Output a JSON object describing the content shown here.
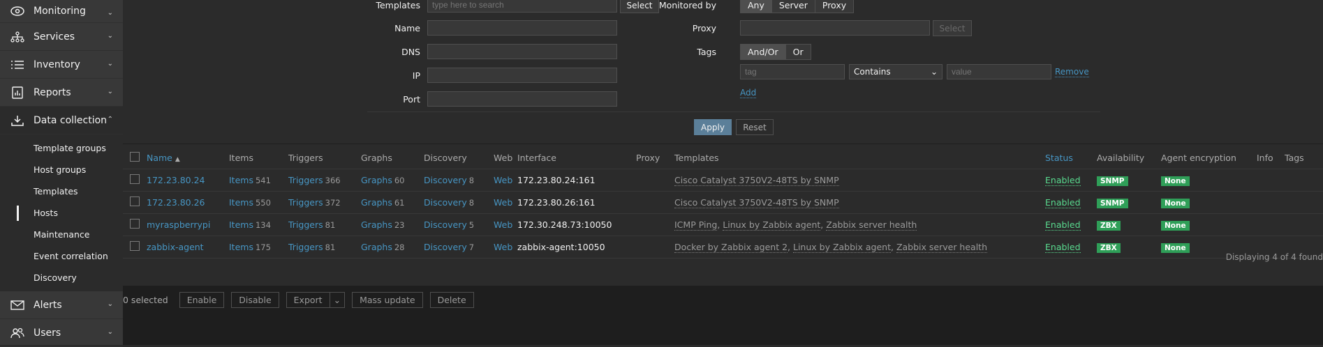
{
  "sidebar": {
    "top_items": [
      {
        "label": "Monitoring",
        "icon": "eye-icon"
      },
      {
        "label": "Services",
        "icon": "services-icon"
      },
      {
        "label": "Inventory",
        "icon": "list-icon"
      },
      {
        "label": "Reports",
        "icon": "report-icon"
      }
    ],
    "data_collection": {
      "label": "Data collection",
      "icon": "download-icon"
    },
    "sub_items": [
      "Template groups",
      "Host groups",
      "Templates",
      "Hosts",
      "Maintenance",
      "Event correlation",
      "Discovery"
    ],
    "bottom_items": [
      {
        "label": "Alerts",
        "icon": "envelope-icon"
      },
      {
        "label": "Users",
        "icon": "users-icon"
      }
    ]
  },
  "filter": {
    "templates_label": "Templates",
    "templates_placeholder": "type here to search",
    "select_label": "Select",
    "name_label": "Name",
    "dns_label": "DNS",
    "ip_label": "IP",
    "port_label": "Port",
    "monitored_by_label": "Monitored by",
    "monitored_options": [
      "Any",
      "Server",
      "Proxy"
    ],
    "proxy_label": "Proxy",
    "proxy_select_label": "Select",
    "tags_label": "Tags",
    "tags_options": [
      "And/Or",
      "Or"
    ],
    "tag_placeholder": "tag",
    "operator_value": "Contains",
    "value_placeholder": "value",
    "remove_label": "Remove",
    "add_label": "Add",
    "apply_label": "Apply",
    "reset_label": "Reset"
  },
  "table": {
    "headers": {
      "name": "Name",
      "items": "Items",
      "triggers": "Triggers",
      "graphs": "Graphs",
      "discovery": "Discovery",
      "web": "Web",
      "interface": "Interface",
      "proxy": "Proxy",
      "templates": "Templates",
      "status": "Status",
      "availability": "Availability",
      "encryption": "Agent encryption",
      "info": "Info",
      "tags": "Tags"
    },
    "sort_indicator": "▲",
    "rows": [
      {
        "name": "172.23.80.24",
        "items": "Items",
        "items_n": "541",
        "triggers": "Triggers",
        "triggers_n": "366",
        "graphs": "Graphs",
        "graphs_n": "60",
        "discovery": "Discovery",
        "discovery_n": "8",
        "web": "Web",
        "interface": "172.23.80.24:161",
        "templates": [
          "Cisco Catalyst 3750V2-48TS by SNMP"
        ],
        "status": "Enabled",
        "availability": "SNMP",
        "encryption": "None"
      },
      {
        "name": "172.23.80.26",
        "items": "Items",
        "items_n": "550",
        "triggers": "Triggers",
        "triggers_n": "372",
        "graphs": "Graphs",
        "graphs_n": "61",
        "discovery": "Discovery",
        "discovery_n": "8",
        "web": "Web",
        "interface": "172.23.80.26:161",
        "templates": [
          "Cisco Catalyst 3750V2-48TS by SNMP"
        ],
        "status": "Enabled",
        "availability": "SNMP",
        "encryption": "None"
      },
      {
        "name": "myraspberrypi",
        "items": "Items",
        "items_n": "134",
        "triggers": "Triggers",
        "triggers_n": "81",
        "graphs": "Graphs",
        "graphs_n": "23",
        "discovery": "Discovery",
        "discovery_n": "5",
        "web": "Web",
        "interface": "172.30.248.73:10050",
        "templates": [
          "ICMP Ping",
          "Linux by Zabbix agent",
          "Zabbix server health"
        ],
        "status": "Enabled",
        "availability": "ZBX",
        "encryption": "None"
      },
      {
        "name": "zabbix-agent",
        "items": "Items",
        "items_n": "175",
        "triggers": "Triggers",
        "triggers_n": "81",
        "graphs": "Graphs",
        "graphs_n": "28",
        "discovery": "Discovery",
        "discovery_n": "7",
        "web": "Web",
        "interface": "zabbix-agent:10050",
        "templates": [
          "Docker by Zabbix agent 2",
          "Linux by Zabbix agent",
          "Zabbix server health"
        ],
        "status": "Enabled",
        "availability": "ZBX",
        "encryption": "None"
      }
    ],
    "paging_text": "Displaying 4 of 4 found"
  },
  "actions": {
    "selected_text": "0 selected",
    "buttons": [
      "Enable",
      "Disable",
      "Export",
      "Mass update",
      "Delete"
    ]
  }
}
